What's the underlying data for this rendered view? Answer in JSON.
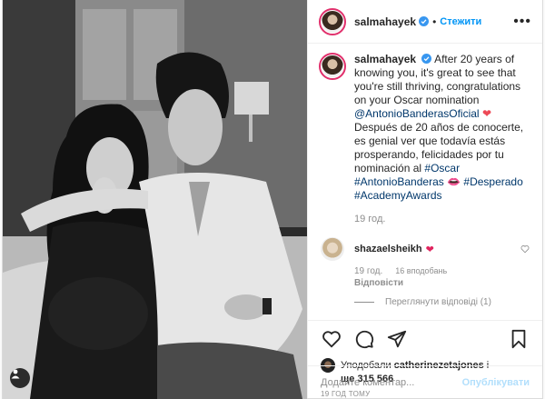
{
  "post": {
    "author": "salmahayek",
    "follow_label": "Стежити",
    "more_label": "•••",
    "caption": {
      "author": "salmahayek",
      "text_en": "After 20 years of knowing you, it's great to see that you're still thriving, congratulations on your Oscar nomination",
      "mention": "@AntonioBanderasOficial",
      "text_es": "Después de 20 años de conocerte, es genial ver que todavía estás prosperando, felicidades por tu nominación al",
      "hashtags": [
        "#Oscar",
        "#AntonioBanderas",
        "#Desperado",
        "#AcademyAwards"
      ],
      "time": "19 год."
    },
    "comments": [
      {
        "author": "shazaelsheikh",
        "time": "19 год.",
        "likes": "16 вподобань",
        "reply_label": "Відповісти",
        "view_replies_label": "Переглянути відповіді (1)"
      }
    ],
    "likes": {
      "prefix": "Уподобали",
      "user": "catherinezetajones",
      "suffix": "і",
      "count_label": "ще 315 566"
    },
    "time_ago": "19 год тому",
    "add_comment_placeholder": "Додайте коментар...",
    "publish_label": "Опублікувати",
    "icons": [
      "heart-icon",
      "comment-icon",
      "share-icon",
      "bookmark-icon",
      "user-tag-icon",
      "verified-icon"
    ],
    "colors": {
      "link": "#00376b",
      "follow": "#0095f6",
      "publish_disabled": "#b2dffc",
      "heart": "#ed4956",
      "muted": "#8e8e8e"
    }
  }
}
